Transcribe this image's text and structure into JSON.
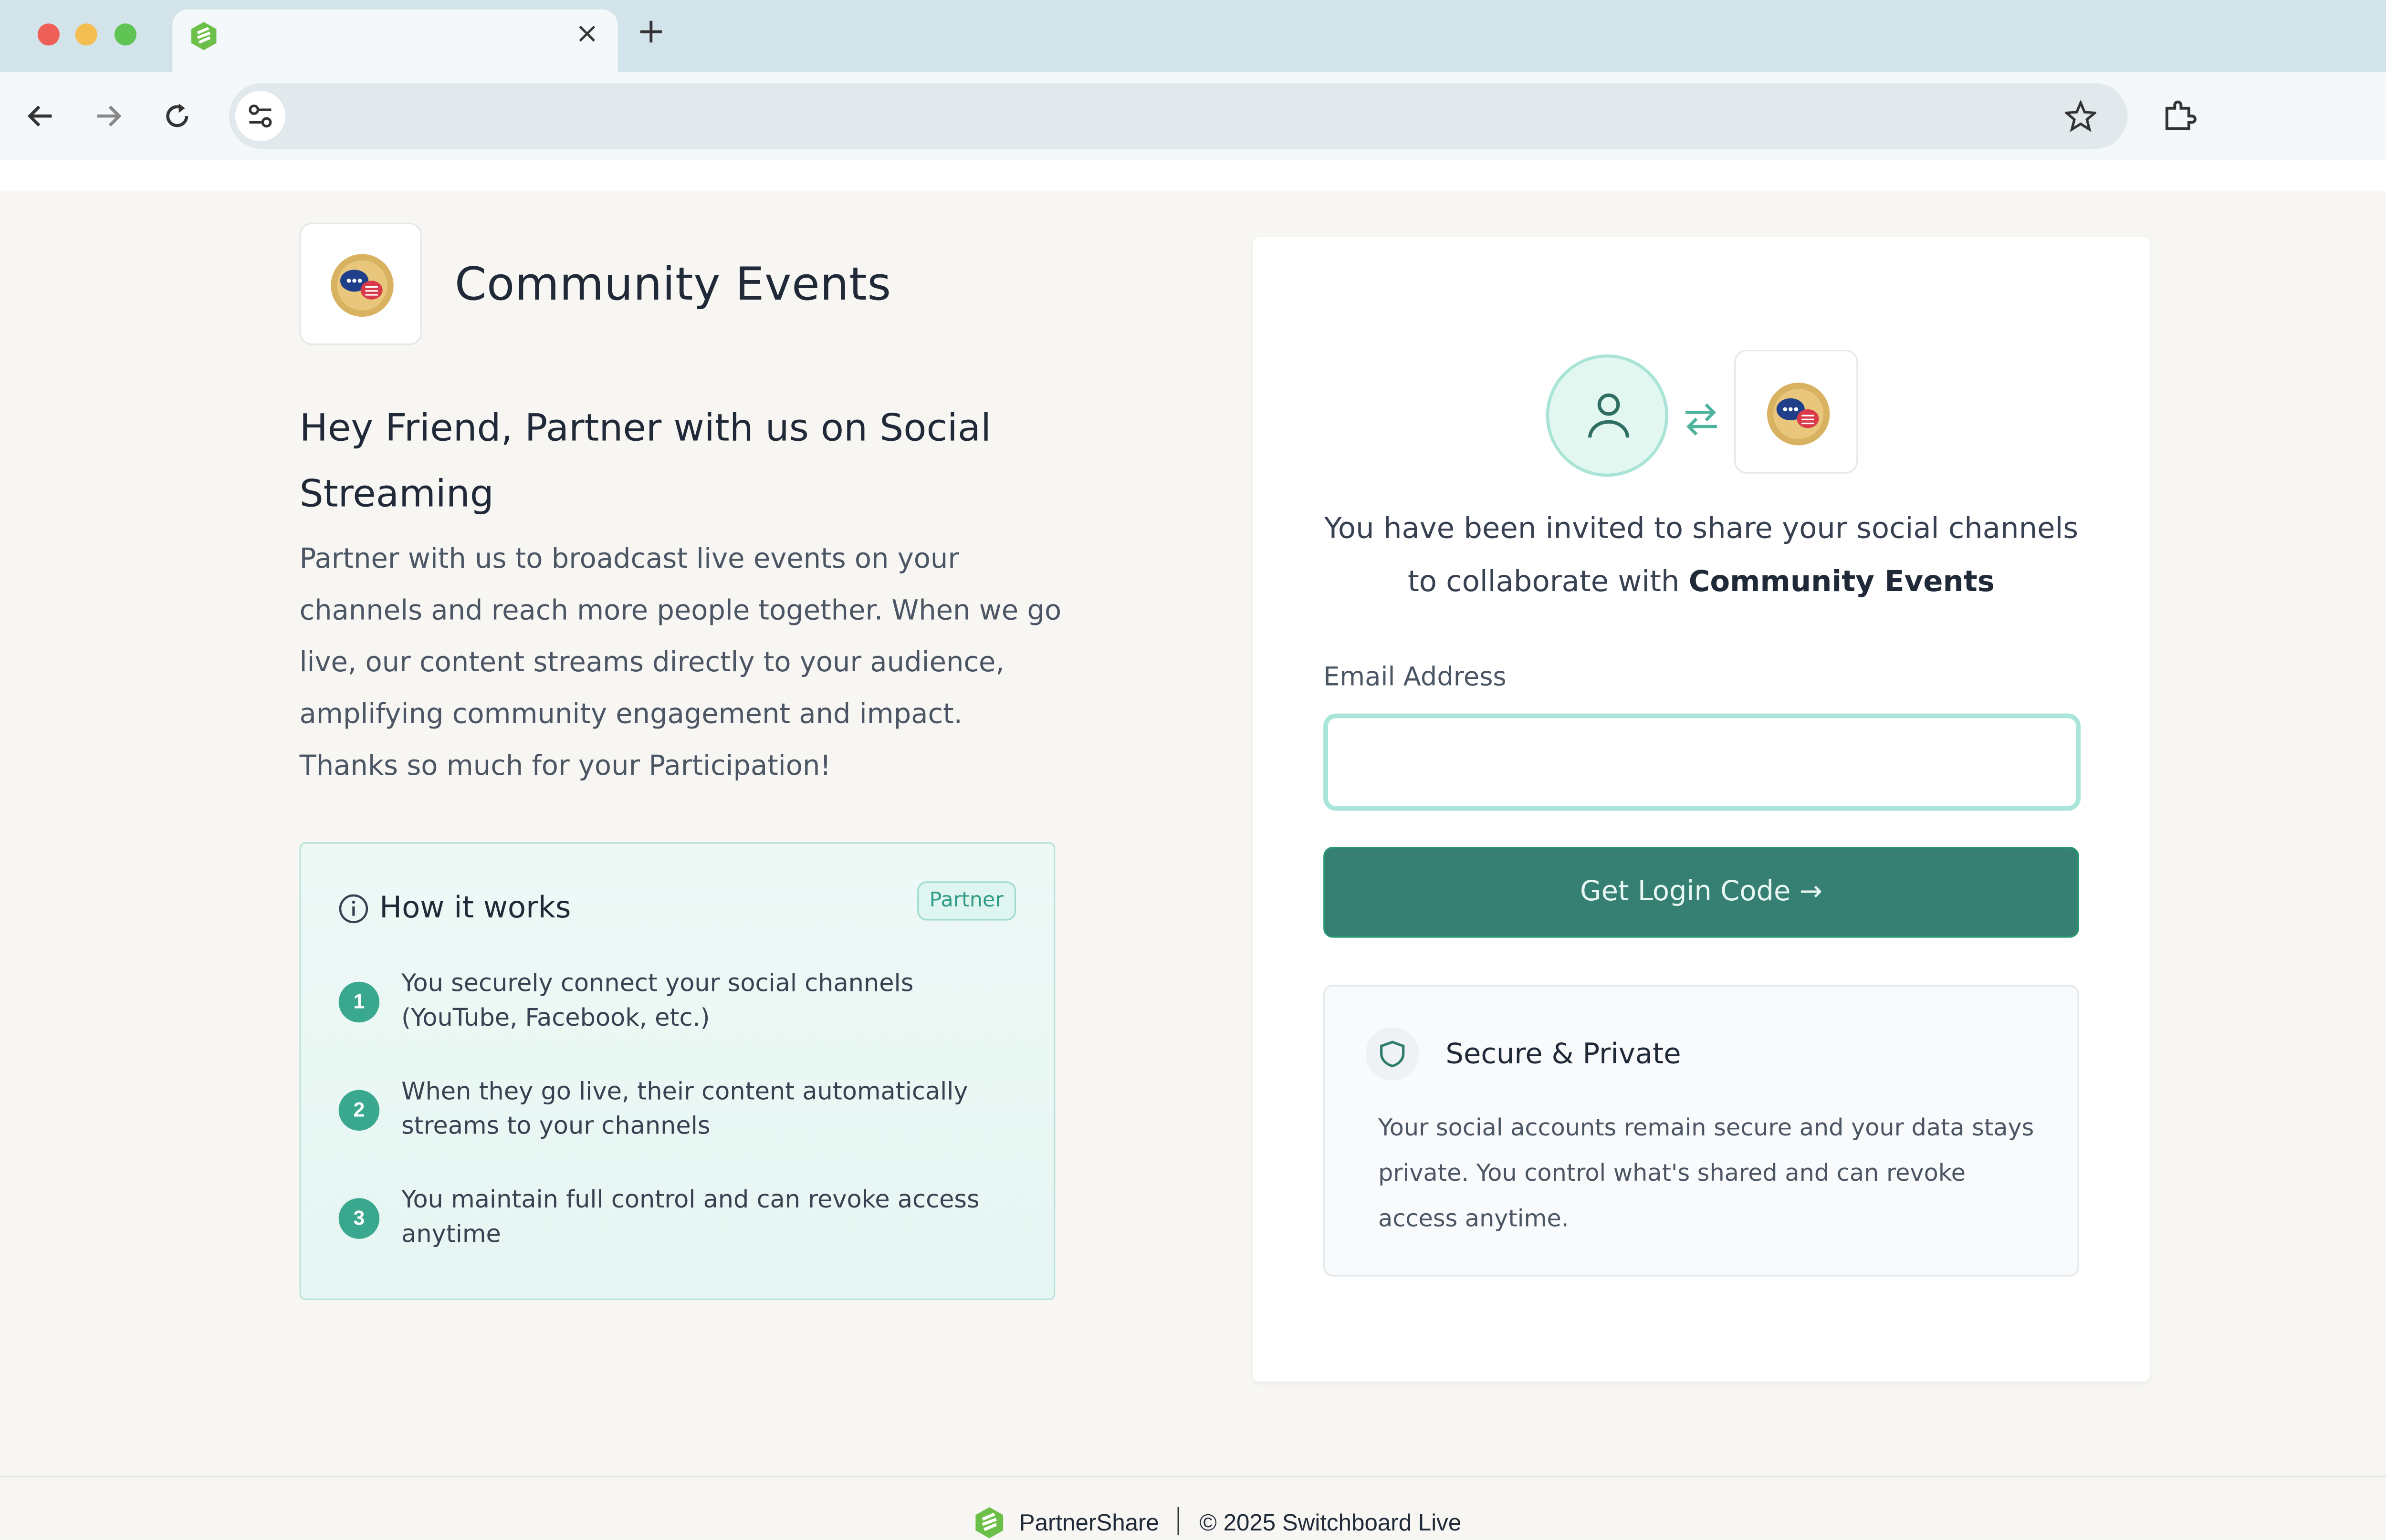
{
  "browser": {
    "tab_close": "×",
    "new_tab": "+",
    "address": ""
  },
  "brand": {
    "name": "Community Events"
  },
  "hero": {
    "headline": "Hey Friend, Partner with us on Social Streaming",
    "intro": "Partner with us to broadcast live events on your channels and reach more people together. When we go live, our content streams directly to your audience, amplifying community engagement and impact. Thanks so much for your Participation!"
  },
  "how_it_works": {
    "title": "How it works",
    "badge": "Partner",
    "steps": [
      {
        "num": "1",
        "text": "You securely connect your social channels (YouTube, Facebook, etc.)"
      },
      {
        "num": "2",
        "text": "When they go live, their content automatically streams to your channels"
      },
      {
        "num": "3",
        "text": "You maintain full control and can revoke access anytime"
      }
    ]
  },
  "login": {
    "invite_prefix": "You have been invited to share your social channels to collaborate with ",
    "invite_org": "Community Events",
    "email_label": "Email Address",
    "email_value": "",
    "cta_label": "Get Login Code →"
  },
  "secure": {
    "title": "Secure & Private",
    "text": "Your social accounts remain secure and your data stays private. You control what's shared and can revoke access anytime."
  },
  "footer": {
    "brand": "PartnerShare",
    "copyright": "© 2025 Switchboard Live"
  },
  "colors": {
    "accent": "#357f73",
    "step_badge": "#3aa78f",
    "mint_bg": "#e6f6f2"
  }
}
